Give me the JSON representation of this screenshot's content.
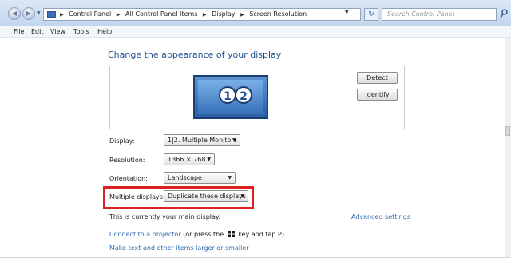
{
  "address_bar": {
    "crumbs": [
      "Control Panel",
      "All Control Panel Items",
      "Display",
      "Screen Resolution"
    ]
  },
  "search": {
    "placeholder": "Search Control Panel"
  },
  "menu": [
    "File",
    "Edit",
    "View",
    "Tools",
    "Help"
  ],
  "page": {
    "title": "Change the appearance of your display",
    "monitor_numbers": [
      "1",
      "2"
    ],
    "detect_label": "Detect",
    "identify_label": "Identify"
  },
  "settings": {
    "display_label": "Display:",
    "display_value": "1|2. Multiple Monitors",
    "resolution_label": "Resolution:",
    "resolution_value": "1366 × 768",
    "orientation_label": "Orientation:",
    "orientation_value": "Landscape",
    "multiple_label": "Multiple displays:",
    "multiple_value": "Duplicate these displays"
  },
  "footer": {
    "main_display_text": "This is currently your main display.",
    "advanced_link": "Advanced settings",
    "projector_link": "Connect to a projector",
    "projector_text_before": "(or press the",
    "projector_text_after": "key and tap P)",
    "larger_link": "Make text and other items larger or smaller"
  },
  "colors": {
    "highlight": "#e02020",
    "link": "#2d6aae",
    "title": "#1f4f8f"
  }
}
